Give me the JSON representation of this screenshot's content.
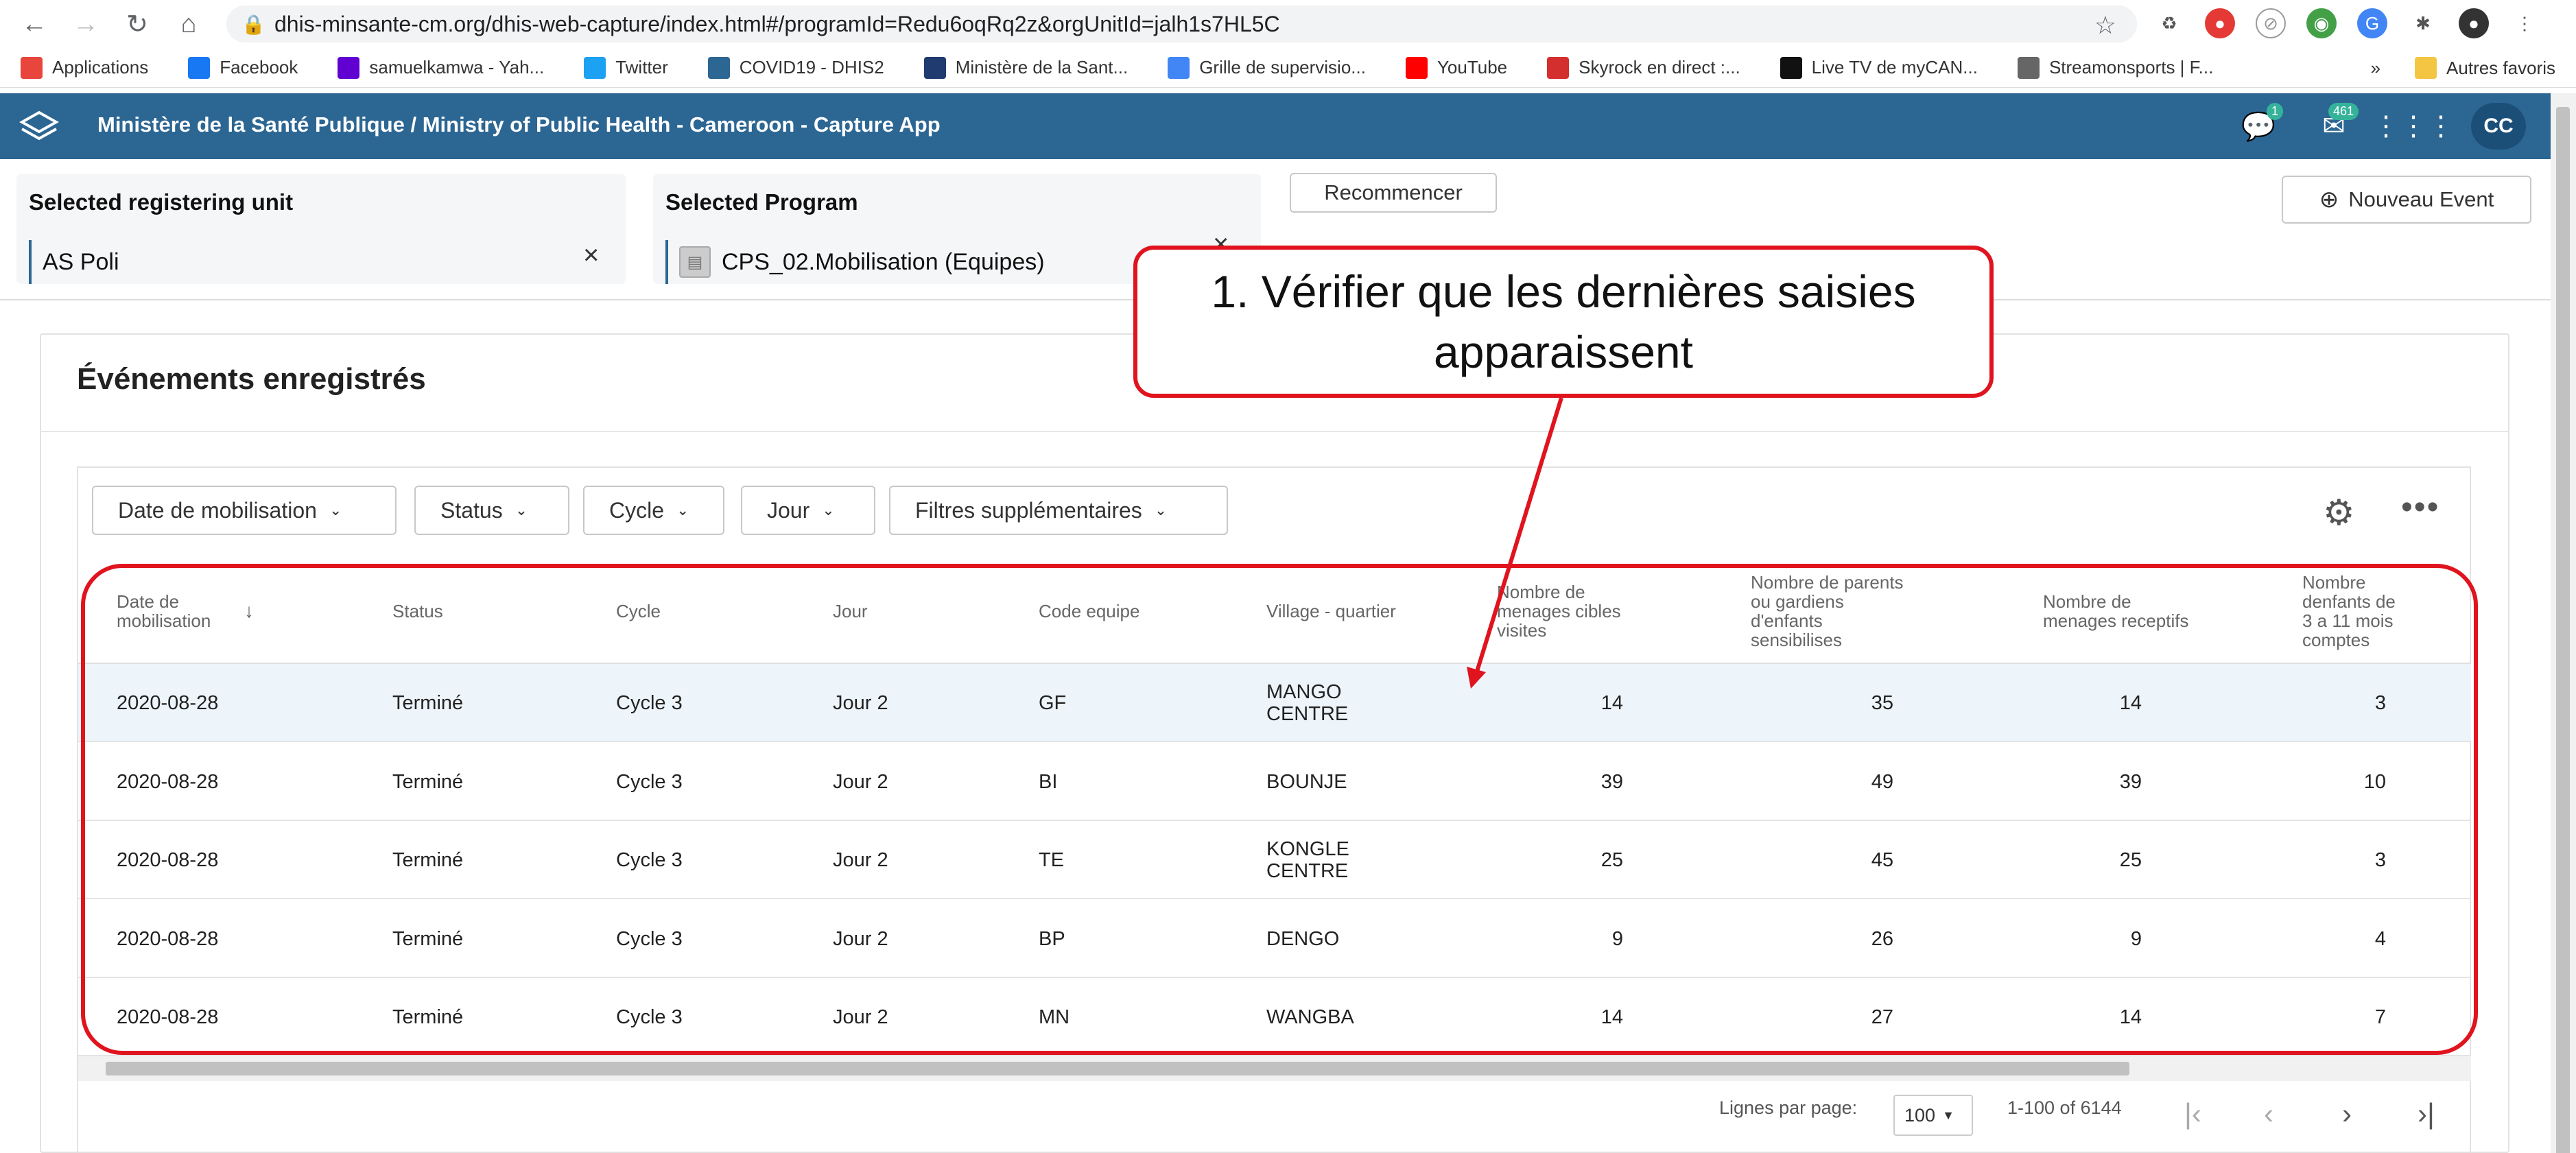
{
  "browser": {
    "url": "dhis-minsante-cm.org/dhis-web-capture/index.html#/programId=Redu6oqRq2z&orgUnitId=jalh1s7HL5C",
    "bookmarks": [
      {
        "label": "Applications",
        "color": "#e8453c",
        "icon": "apps-icon"
      },
      {
        "label": "Facebook",
        "color": "#1877f2",
        "icon": "facebook-icon"
      },
      {
        "label": "samuelkamwa - Yah...",
        "color": "#6001d2",
        "icon": "mail-icon"
      },
      {
        "label": "Twitter",
        "color": "#1da1f2",
        "icon": "twitter-icon"
      },
      {
        "label": "COVID19 - DHIS2",
        "color": "#2c6693",
        "icon": "dhis-icon"
      },
      {
        "label": "Ministère de la Sant...",
        "color": "#1f3b6f",
        "icon": "number-icon"
      },
      {
        "label": "Grille de supervisio...",
        "color": "#4285f4",
        "icon": "doc-icon"
      },
      {
        "label": "YouTube",
        "color": "#ff0000",
        "icon": "youtube-icon"
      },
      {
        "label": "Skyrock en direct :...",
        "color": "#d32f2f",
        "icon": "skyrock-icon"
      },
      {
        "label": "Live TV de myCAN...",
        "color": "#111111",
        "icon": "plus-icon"
      },
      {
        "label": "Streamonsports | F...",
        "color": "#666666",
        "icon": "globe-icon"
      }
    ],
    "other_bookmarks": "Autres favoris",
    "more": "»"
  },
  "header": {
    "title": "Ministère de la Santé Publique / Ministry of Public Health - Cameroon - Capture App",
    "messages_badge": "1",
    "mail_badge": "461",
    "avatar": "CC"
  },
  "selection": {
    "unit_title": "Selected registering unit",
    "unit_value": "AS Poli",
    "program_title": "Selected Program",
    "program_value": "CPS_02.Mobilisation (Equipes)",
    "reset_label": "Recommencer",
    "new_event_label": "Nouveau Event",
    "clear_icon": "×"
  },
  "events": {
    "title": "Événements enregistrés",
    "filters": [
      "Date de mobilisation",
      "Status",
      "Cycle",
      "Jour",
      "Filtres supplémentaires"
    ],
    "columns": [
      "Date de mobilisation",
      "Status",
      "Cycle",
      "Jour",
      "Code equipe",
      "Village - quartier",
      "Nombre de menages cibles visites",
      "Nombre de parents ou gardiens d'enfants sensibilises",
      "Nombre de menages receptifs",
      "Nombre denfants de 3 a 11 mois comptes"
    ],
    "sort_indicator": "↓",
    "rows": [
      [
        "2020-08-28",
        "Terminé",
        "Cycle 3",
        "Jour 2",
        "GF",
        "MANGO CENTRE",
        "14",
        "35",
        "14",
        "3"
      ],
      [
        "2020-08-28",
        "Terminé",
        "Cycle 3",
        "Jour 2",
        "BI",
        "BOUNJE",
        "39",
        "49",
        "39",
        "10"
      ],
      [
        "2020-08-28",
        "Terminé",
        "Cycle 3",
        "Jour 2",
        "TE",
        "KONGLE CENTRE",
        "25",
        "45",
        "25",
        "3"
      ],
      [
        "2020-08-28",
        "Terminé",
        "Cycle 3",
        "Jour 2",
        "BP",
        "DENGO",
        "9",
        "26",
        "9",
        "4"
      ],
      [
        "2020-08-28",
        "Terminé",
        "Cycle 3",
        "Jour 2",
        "MN",
        "WANGBA",
        "14",
        "27",
        "14",
        "7"
      ]
    ]
  },
  "pagination": {
    "rows_label": "Lignes par page:",
    "rows_value": "100",
    "range": "1-100 of 6144"
  },
  "annotation": {
    "callout": "1. Vérifier que les dernières saisies apparaissent",
    "color": "#e0141e"
  }
}
